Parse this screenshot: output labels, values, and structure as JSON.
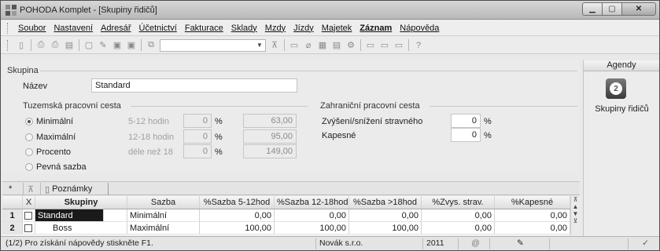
{
  "window": {
    "title": "POHODA Komplet - [Skupiny řidičů]"
  },
  "menu": [
    "Soubor",
    "Nastavení",
    "Adresář",
    "Účetnictví",
    "Fakturace",
    "Sklady",
    "Mzdy",
    "Jízdy",
    "Majetek",
    "Záznam",
    "Nápověda"
  ],
  "form": {
    "section_skupina": "Skupina",
    "name_label": "Název",
    "name_value": "Standard",
    "domestic_title": "Tuzemská pracovní cesta",
    "foreign_title": "Zahraniční pracovní cesta",
    "radios": [
      {
        "label": "Minimální",
        "range": "5-12 hodin",
        "pct": "0",
        "unit": "%",
        "amount": "63,00",
        "checked": true
      },
      {
        "label": "Maximální",
        "range": "12-18 hodin",
        "pct": "0",
        "unit": "%",
        "amount": "95,00",
        "checked": false
      },
      {
        "label": "Procento",
        "range": "déle než 18",
        "pct": "0",
        "unit": "%",
        "amount": "149,00",
        "checked": false
      },
      {
        "label": "Pevná sazba",
        "checked": false
      }
    ],
    "foreign": [
      {
        "label": "Zvýšení/snížení stravného",
        "value": "0",
        "unit": "%"
      },
      {
        "label": "Kapesné",
        "value": "0",
        "unit": "%"
      }
    ]
  },
  "agendy": {
    "header": "Agendy",
    "item_label": "Skupiny řidičů",
    "icon_glyph": "2"
  },
  "tabs": {
    "star": "*",
    "filter_icon": "⊼",
    "notes": "Poznámky"
  },
  "grid": {
    "columns": [
      "X",
      "Skupiny",
      "Sazba",
      "%Sazba 5-12hod",
      "%Sazba 12-18hod",
      "%Sazba >18hod",
      "%Zvys. strav.",
      "%Kapesné"
    ],
    "rows": [
      {
        "num": "1",
        "skupiny": "Standard",
        "sazba": "Minimální",
        "s1": "0,00",
        "s2": "0,00",
        "s3": "0,00",
        "zvys": "0,00",
        "kap": "0,00"
      },
      {
        "num": "2",
        "skupiny": "Boss",
        "sazba": "Maximální",
        "s1": "100,00",
        "s2": "100,00",
        "s3": "100,00",
        "zvys": "0,00",
        "kap": "0,00"
      }
    ]
  },
  "status": {
    "records": "(1/2) Pro získání nápovědy stiskněte F1.",
    "company": "Novák s.r.o.",
    "year": "2011",
    "at": "@"
  }
}
